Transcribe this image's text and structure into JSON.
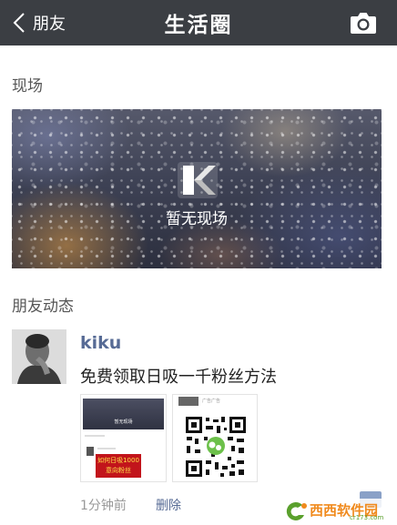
{
  "navbar": {
    "back_label": "朋友",
    "title": "生活圈",
    "background": "#3b3e43"
  },
  "live": {
    "section_title": "现场",
    "empty_text": "暂无现场"
  },
  "friends": {
    "section_title": "朋友动态"
  },
  "post": {
    "author": "kiku",
    "text": "免费领取日吸一千粉丝方法",
    "time": "1分钟前",
    "delete_label": "删除",
    "images": [
      {
        "live_text": "暂无现场",
        "promo_text": "如何日吸1000\n意向粉丝"
      },
      {
        "header_text": "广告广告"
      }
    ]
  },
  "watermark": {
    "text": "西西软件园",
    "sub": "cr173.com"
  },
  "colors": {
    "link": "#576b95",
    "nav": "#3b3e43",
    "watermark_orange": "#f08a1d",
    "watermark_green": "#5aa02c"
  }
}
